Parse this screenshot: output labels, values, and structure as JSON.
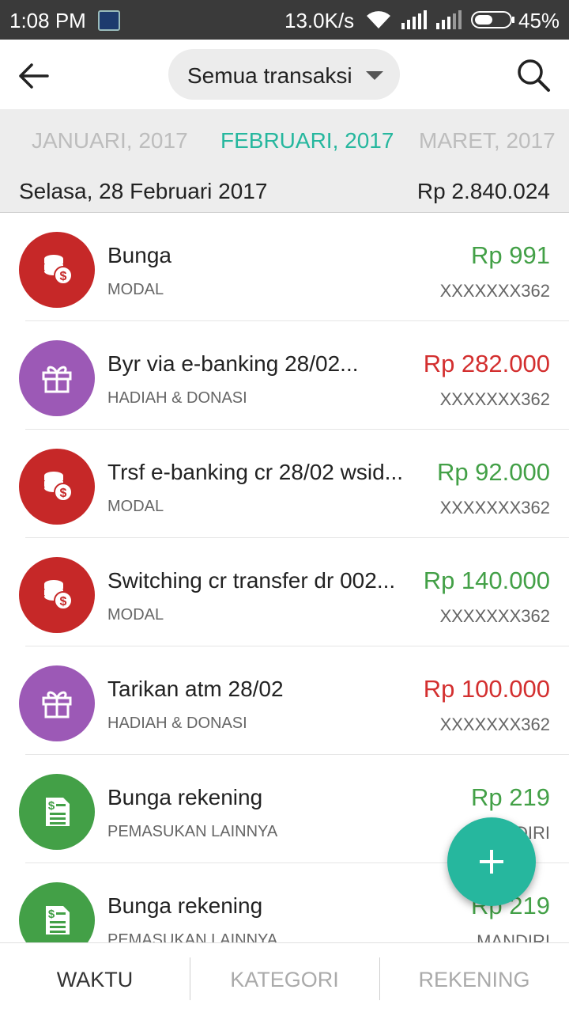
{
  "status_bar": {
    "time": "1:08 PM",
    "net_speed": "13.0K/s",
    "battery": "45%"
  },
  "app_bar": {
    "filter_label": "Semua transaksi",
    "back_icon": "arrow-left-icon",
    "search_icon": "search-icon"
  },
  "months": {
    "prev": "JANUARI, 2017",
    "current": "FEBRUARI, 2017",
    "next": "MARET, 2017"
  },
  "day_header": {
    "date": "Selasa, 28 Februari 2017",
    "total": "Rp 2.840.024"
  },
  "colors": {
    "accent": "#26b79e",
    "income": "#43a047",
    "expense": "#d32f2f",
    "modal_bg": "#c62828",
    "gift_bg": "#9c59b6",
    "other_income_bg": "#43a047"
  },
  "transactions": [
    {
      "title": "Bunga",
      "category": "MODAL",
      "amount": "Rp 991",
      "account": "XXXXXXX362",
      "type": "income",
      "icon": "coins-icon"
    },
    {
      "title": "Byr via e-banking 28/02...",
      "category": "HADIAH & DONASI",
      "amount": "Rp 282.000",
      "account": "XXXXXXX362",
      "type": "expense",
      "icon": "gift-icon"
    },
    {
      "title": "Trsf e-banking cr 28/02 wsid...",
      "category": "MODAL",
      "amount": "Rp 92.000",
      "account": "XXXXXXX362",
      "type": "income",
      "icon": "coins-icon"
    },
    {
      "title": "Switching cr transfer dr 002...",
      "category": "MODAL",
      "amount": "Rp 140.000",
      "account": "XXXXXXX362",
      "type": "income",
      "icon": "coins-icon"
    },
    {
      "title": "Tarikan atm 28/02",
      "category": "HADIAH & DONASI",
      "amount": "Rp 100.000",
      "account": "XXXXXXX362",
      "type": "expense",
      "icon": "gift-icon"
    },
    {
      "title": "Bunga rekening",
      "category": "PEMASUKAN LAINNYA",
      "amount": "Rp 219",
      "account": "MANDIRI",
      "type": "income",
      "icon": "receipt-icon"
    },
    {
      "title": "Bunga rekening",
      "category": "PEMASUKAN LAINNYA",
      "amount": "Rp 219",
      "account": "MANDIRI",
      "type": "income",
      "icon": "receipt-icon"
    }
  ],
  "bottom_nav": {
    "tabs": [
      "WAKTU",
      "KATEGORI",
      "REKENING"
    ],
    "active": "WAKTU"
  }
}
